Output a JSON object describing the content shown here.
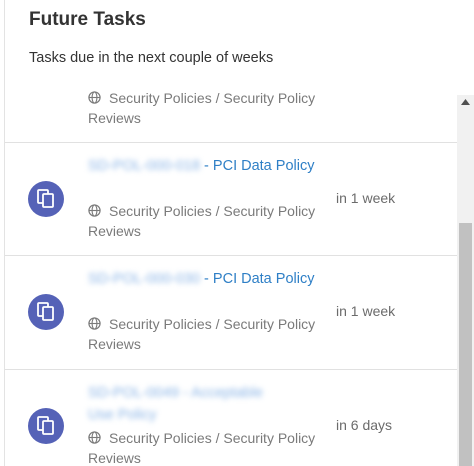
{
  "header": {
    "title": "Future Tasks",
    "subtitle": "Tasks due in the next couple of weeks"
  },
  "partial_task": {
    "category_icon": "globe-icon",
    "category": "Security Policies / Security Policy Reviews"
  },
  "tasks": [
    {
      "avatar_icon": "documents-icon",
      "id": "SD-POL-000-018",
      "separator": " - ",
      "title": "PCI Data Policy",
      "category_icon": "globe-icon",
      "category": "Security Policies / Security Policy Reviews",
      "due": "in 1 week"
    },
    {
      "avatar_icon": "documents-icon",
      "id": "SD-POL-000-030",
      "separator": " - ",
      "title": "PCI Data Policy",
      "category_icon": "globe-icon",
      "category": "Security Policies / Security Policy Reviews",
      "due": "in 1 week"
    },
    {
      "avatar_icon": "documents-icon",
      "id": "SD-POL-0049 - Acceptable Use Policy",
      "separator": "",
      "title": "",
      "category_icon": "globe-icon",
      "category": "Security Policies / Security Policy Reviews",
      "due": "in 6 days"
    }
  ],
  "colors": {
    "avatar": "#5562b7",
    "link": "#2e7fc6",
    "muted_text": "#7a7a7a",
    "scroll_thumb": "#c1c1c1"
  }
}
